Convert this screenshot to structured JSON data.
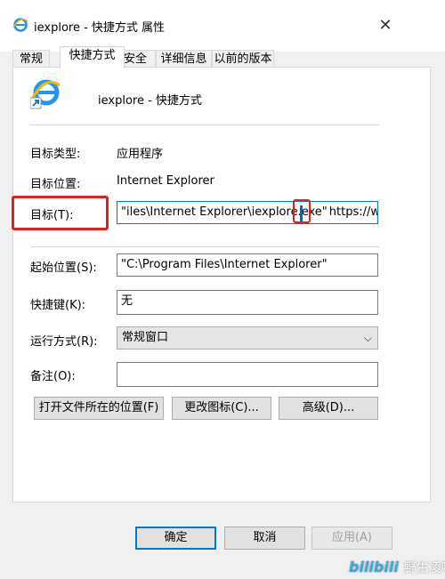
{
  "window": {
    "title": "iexplore - 快捷方式 属性",
    "close_glyph": "✕"
  },
  "tabs": [
    {
      "label": "常规"
    },
    {
      "label": "快捷方式"
    },
    {
      "label": "安全"
    },
    {
      "label": "详细信息"
    },
    {
      "label": "以前的版本"
    }
  ],
  "header": {
    "name": "iexplore - 快捷方式"
  },
  "fields": {
    "target_type_label": "目标类型:",
    "target_type_value": "应用程序",
    "target_location_label": "目标位置:",
    "target_location_value": "Internet Explorer",
    "target_label": "目标(T):",
    "target_value_left": "\"iles\\Internet Explorer\\iexplore.exe",
    "target_value_quote": "\"",
    "target_value_right": "https://www.b",
    "start_in_label": "起始位置(S):",
    "start_in_value": "\"C:\\Program Files\\Internet Explorer\"",
    "hotkey_label": "快捷键(K):",
    "hotkey_value": "无",
    "run_label": "运行方式(R):",
    "run_value": "常规窗口",
    "comment_label": "备注(O):",
    "comment_value": ""
  },
  "buttons": {
    "open_location": "打开文件所在的位置(F)",
    "change_icon": "更改图标(C)...",
    "advanced": "高级(D)...",
    "ok": "确定",
    "cancel": "取消",
    "apply": "应用(A)"
  },
  "watermark": {
    "logo": "bilibili",
    "text": "野生凌喵"
  },
  "colors": {
    "accent": "#0078d7",
    "highlight_red": "#e0201c"
  }
}
